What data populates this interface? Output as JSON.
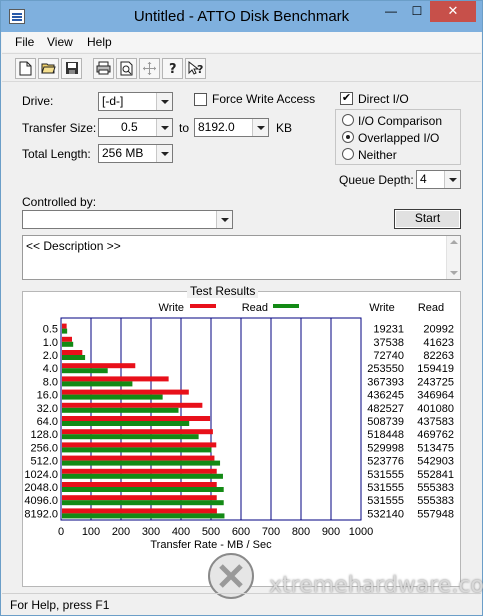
{
  "window": {
    "title": "Untitled - ATTO Disk Benchmark",
    "minimize": "—",
    "maximize": "☐",
    "close": "✕"
  },
  "menu": {
    "file": "File",
    "view": "View",
    "help": "Help"
  },
  "toolbar": {
    "icons": [
      "new-document-icon",
      "open-folder-icon",
      "save-icon",
      "print-icon",
      "print-preview-icon",
      "move-icon",
      "help-icon",
      "context-help-icon"
    ]
  },
  "settings": {
    "drive_label": "Drive:",
    "drive_value": "[-d-]",
    "transfer_size_label": "Transfer Size:",
    "transfer_from": "0.5",
    "to_label": "to",
    "transfer_to": "8192.0",
    "kb_label": "KB",
    "total_length_label": "Total Length:",
    "total_length_value": "256 MB",
    "force_write_label": "Force Write Access",
    "force_write_checked": false,
    "direct_io_label": "Direct I/O",
    "direct_io_checked": true,
    "io_comparison_label": "I/O Comparison",
    "overlapped_io_label": "Overlapped I/O",
    "neither_label": "Neither",
    "io_mode_selected": "Overlapped I/O",
    "queue_depth_label": "Queue Depth:",
    "queue_depth_value": "4",
    "controlled_by_label": "Controlled by:",
    "controlled_by_value": "",
    "start_label": "Start",
    "description": "<< Description >>"
  },
  "results": {
    "title": "Test Results",
    "write_legend": "Write",
    "read_legend": "Read",
    "write_col": "Write",
    "read_col": "Read",
    "xlabel": "Transfer Rate - MB / Sec",
    "write_color": "#e8101a",
    "read_color": "#138a15"
  },
  "chart_data": {
    "type": "bar",
    "orientation": "horizontal",
    "title": "Test Results",
    "xlabel": "Transfer Rate - MB / Sec",
    "xlim": [
      0,
      1000
    ],
    "x_ticks": [
      "0",
      "100",
      "200",
      "300",
      "400",
      "500",
      "600",
      "700",
      "800",
      "900",
      "1000"
    ],
    "categories": [
      "0.5",
      "1.0",
      "2.0",
      "4.0",
      "8.0",
      "16.0",
      "32.0",
      "64.0",
      "128.0",
      "256.0",
      "512.0",
      "1024.0",
      "2048.0",
      "4096.0",
      "8192.0"
    ],
    "series": [
      {
        "name": "Write",
        "color": "#e8101a",
        "values_kbps": [
          19231,
          37538,
          72740,
          253550,
          367393,
          436245,
          482527,
          508739,
          518448,
          529998,
          523776,
          531555,
          531555,
          531555,
          532140
        ]
      },
      {
        "name": "Read",
        "color": "#138a15",
        "values_kbps": [
          20992,
          41623,
          82263,
          159419,
          243725,
          346964,
          401080,
          437583,
          469762,
          513475,
          542903,
          552841,
          555383,
          555383,
          557948
        ]
      }
    ]
  },
  "status": {
    "text": "For Help, press F1"
  },
  "watermark": {
    "text": "xtremehardware.com"
  }
}
